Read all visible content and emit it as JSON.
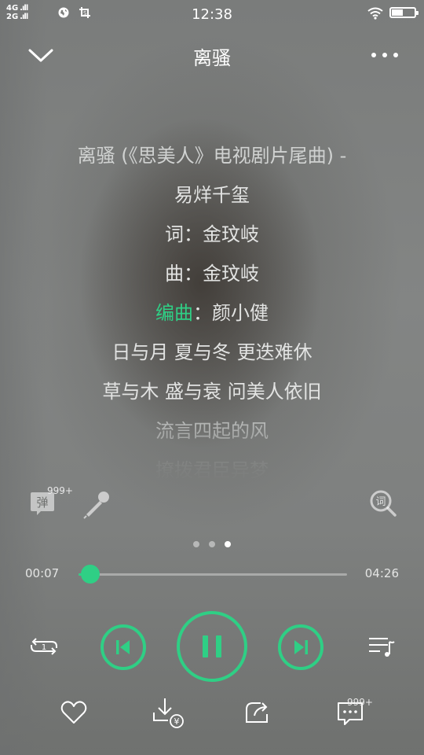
{
  "status_bar": {
    "network_top": "4G",
    "network_bottom": "2G",
    "time": "12:38",
    "icons": [
      "signal-icon",
      "globe-icon",
      "screenshot-icon",
      "wifi-icon",
      "battery-icon"
    ]
  },
  "header": {
    "title": "离骚"
  },
  "lyrics": {
    "lines": [
      "离骚 (《思美人》电视剧片尾曲) -",
      "易烊千玺",
      "词：金玟岐",
      "曲：金玟岐",
      "",
      "日与月 夏与冬 更迭难休",
      "草与木 盛与衰 问美人依旧",
      "流言四起的风",
      "撩拨君臣异梦"
    ],
    "current_line": {
      "highlighted": "编曲",
      "rest": "：颜小健"
    }
  },
  "actions": {
    "danmu_label": "弹",
    "danmu_badge": "999+",
    "lyric_search_label": "词"
  },
  "pager": {
    "count": 3,
    "active_index": 2
  },
  "progress": {
    "current": "00:07",
    "total": "04:26",
    "fraction": 0.027
  },
  "bottom": {
    "comment_badge": "999+"
  },
  "colors": {
    "accent": "#2fcf85",
    "text": "#ffffff"
  }
}
